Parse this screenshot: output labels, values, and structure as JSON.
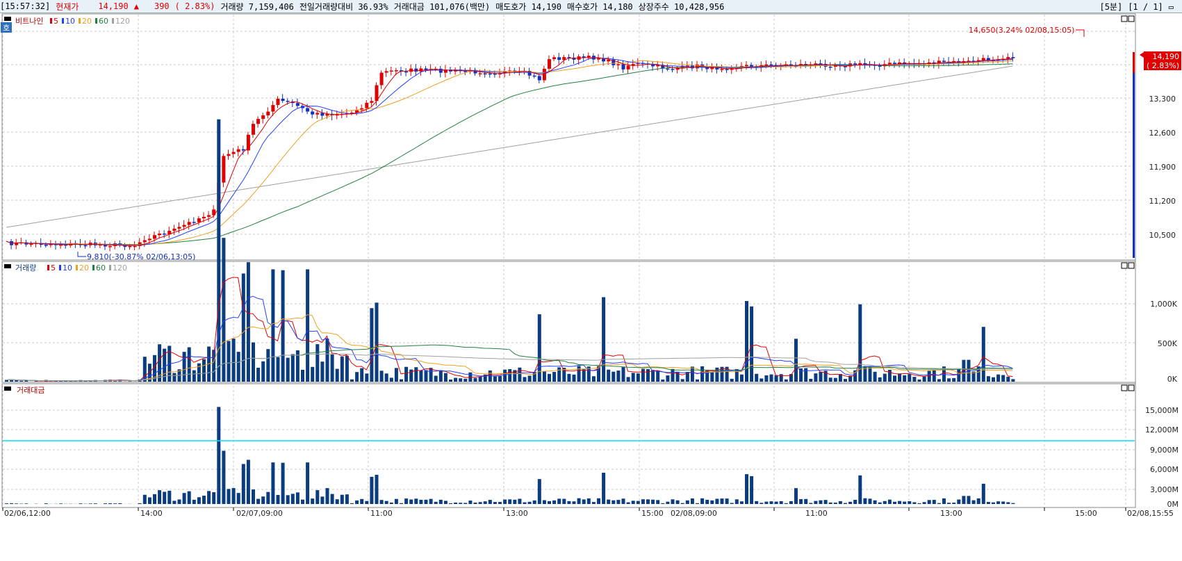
{
  "header": {
    "time": "[15:57:32]",
    "price_label": "현재가",
    "price": "14,190",
    "arrow": "▲",
    "change": "390",
    "change_pct": "( 2.83%)",
    "volume": "거래량 7,159,406",
    "prev_vol_ratio": "전일거래량대비 36.93%",
    "amount": "거래대금 101,076(백만)",
    "ask": "매도호가 14,190",
    "bid": "매수호가 14,180",
    "shares": "상장주수 10,428,956",
    "interval": "[5분]",
    "page": "[1 / 1]"
  },
  "panels": {
    "price": {
      "legend_name": "비트나인",
      "ma_labels": [
        "5",
        "10",
        "20",
        "60",
        "120"
      ],
      "ma_colors": [
        "#e00000",
        "#2040ff",
        "#f0a020",
        "#208040",
        "#a0a0a0"
      ],
      "y_ticks": [
        "13,300",
        "12,600",
        "11,900",
        "11,200",
        "10,500"
      ],
      "price_tag": "14,190",
      "price_tag_pct": "( 2.83%)",
      "high_note": "14,650(3.24% 02/08,15:05)",
      "low_note": "9,810(-30.87% 02/06,13:05)"
    },
    "volume": {
      "legend_name": "거래량",
      "ma_labels": [
        "5",
        "10",
        "20",
        "60",
        "120"
      ],
      "y_ticks": [
        "1,000K",
        "500K",
        "0K"
      ]
    },
    "amount": {
      "legend_name": "거래대금",
      "y_ticks": [
        "15,000M",
        "12,000M",
        "9,000M",
        "6,000M",
        "3,000M",
        "0M"
      ]
    }
  },
  "x_ticks": [
    "02/06,12:00",
    "14:00",
    "02/07,09:00",
    "11:00",
    "13:00",
    "15:00",
    "02/08,09:00",
    "11:00",
    "13:00",
    "15:00",
    "02/08,15:55"
  ],
  "colors": {
    "up": "#e00000",
    "down": "#1030c0",
    "bar": "#0c3c80",
    "cyan": "#00e0ff"
  }
}
